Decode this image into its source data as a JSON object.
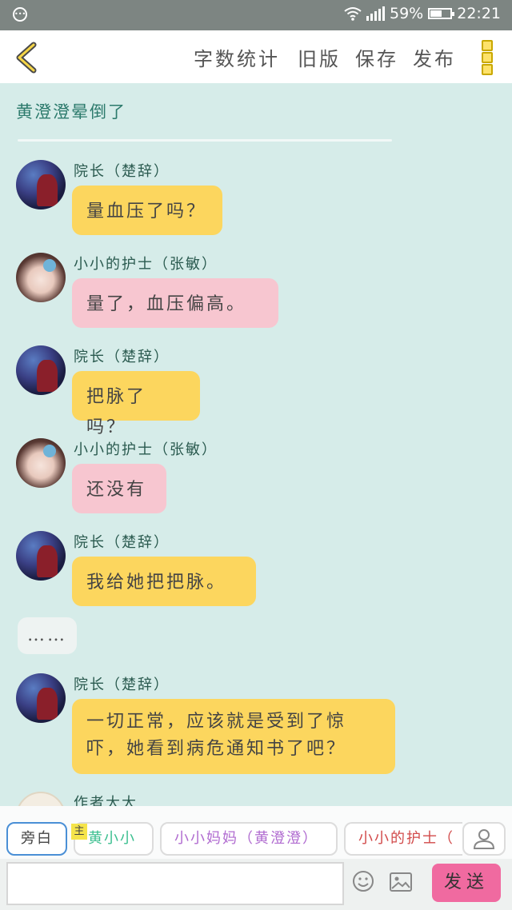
{
  "status_bar": {
    "battery": "59%",
    "battery_level": 0.59,
    "time": "22:21"
  },
  "toolbar": {
    "word_count": "字数统计",
    "old_version": "旧版",
    "save": "保存",
    "publish": "发布"
  },
  "story": {
    "title": "黄澄澄晕倒了"
  },
  "messages": [
    {
      "speaker": "院长（楚辞）",
      "text": "量血压了吗？",
      "color": "#fcd65e"
    },
    {
      "speaker": "小小的护士（张敏）",
      "text": "量了，血压偏高。",
      "color": "#f7c6d0"
    },
    {
      "speaker": "院长（楚辞）",
      "text": "把脉了吗？",
      "color": "#fcd65e"
    },
    {
      "speaker": "小小的护士（张敏）",
      "text": "还没有",
      "color": "#f7c6d0"
    },
    {
      "speaker": "院长（楚辞）",
      "text": "我给她把把脉。",
      "color": "#fcd65e"
    },
    {
      "narration": "……"
    },
    {
      "speaker": "院长（楚辞）",
      "text": "一切正常，应该就是受到了惊吓，她看到病危通知书了吧？",
      "color": "#fcd65e"
    },
    {
      "speaker": "作者大大"
    }
  ],
  "role_tabs": {
    "narration": "旁白",
    "main_badge": "主",
    "tab1": "黄小小",
    "tab2": "小小妈妈（黄澄澄）",
    "tab3": "小小的护士（"
  },
  "input": {
    "send": "发送"
  }
}
